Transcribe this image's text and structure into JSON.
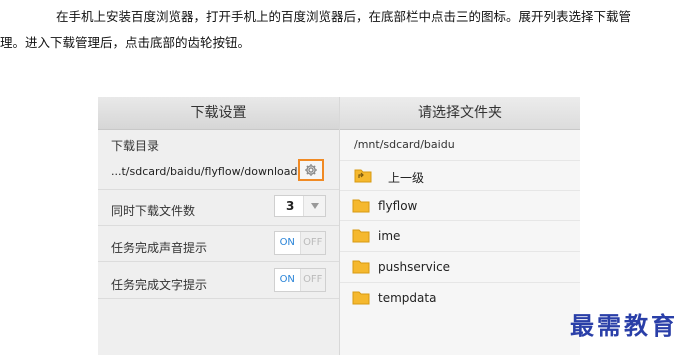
{
  "intro": {
    "line1": "在手机上安装百度浏览器，打开手机上的百度浏览器后，在底部栏中点击三的图标。展开列表选择下载管",
    "line2": "理。进入下载管理后，点击底部的齿轮按钮。"
  },
  "settings": {
    "header": "下载设置",
    "download_dir_label": "下载目录",
    "download_path": "...t/sdcard/baidu/flyflow/downloads/",
    "concurrent_label": "同时下载文件数",
    "concurrent_value": "3",
    "sound_label": "任务完成声音提示",
    "sound_on": "ON",
    "sound_off": "OFF",
    "text_label": "任务完成文字提示",
    "text_on": "ON",
    "text_off": "OFF"
  },
  "folder_picker": {
    "header": "请选择文件夹",
    "current_path": "/mnt/sdcard/baidu",
    "up_label": "上一级",
    "folders": [
      "flyflow",
      "ime",
      "pushservice",
      "tempdata"
    ]
  },
  "colors": {
    "highlight": "#f08a24",
    "folder": "#f5b82e",
    "toggle_on": "#2a84d8"
  },
  "watermark": "最需教育"
}
